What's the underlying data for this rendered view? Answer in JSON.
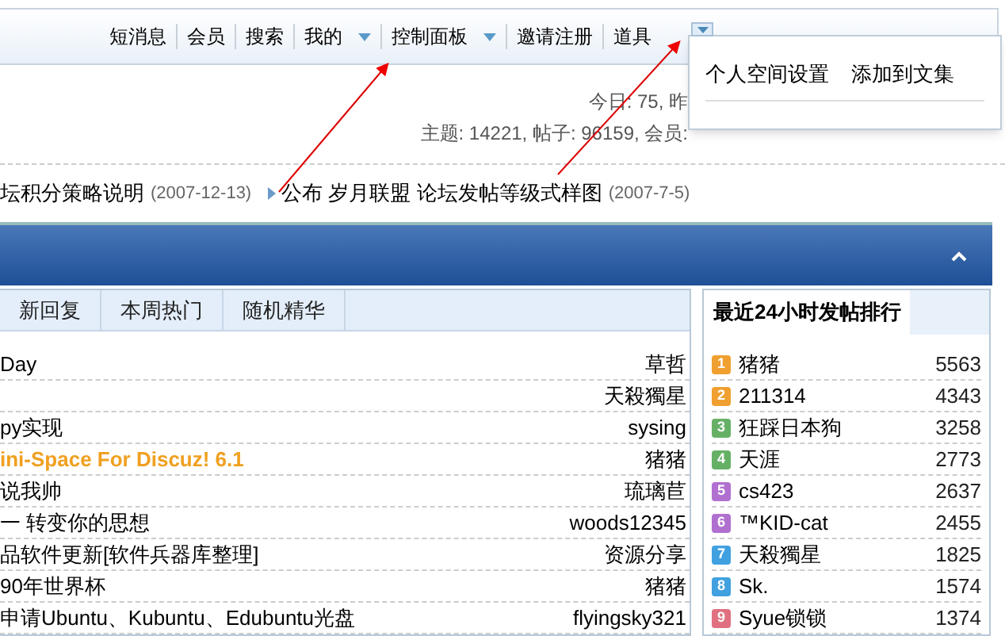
{
  "nav": {
    "items": [
      {
        "label": "短消息",
        "dropdown": false
      },
      {
        "label": "会员",
        "dropdown": false
      },
      {
        "label": "搜索",
        "dropdown": false
      },
      {
        "label": "我的",
        "dropdown": true
      },
      {
        "label": "控制面板",
        "dropdown": true
      },
      {
        "label": "邀请注册",
        "dropdown": false
      },
      {
        "label": "道具",
        "dropdown": false
      }
    ]
  },
  "dropdown_menu": {
    "open": true,
    "items": [
      "个人空间设置",
      "添加到文集"
    ]
  },
  "stats": [
    "今日: 75, 昨",
    "主题: 14221, 帖子: 96159, 会员:"
  ],
  "announcements": [
    {
      "title": "坛积分策略说明",
      "date": "(2007-12-13)"
    },
    {
      "title": "公布 岁月联盟 论坛发帖等级式样图",
      "date": "(2007-7-5)"
    }
  ],
  "tabs": [
    {
      "label": "新回复",
      "selected": false
    },
    {
      "label": "本周热门",
      "selected": false
    },
    {
      "label": "随机精华",
      "selected": false
    }
  ],
  "threads": [
    {
      "title": "Day",
      "author": "草哲",
      "highlight": false
    },
    {
      "author": "天殺獨星"
    },
    {
      "title": "py实现",
      "author": "sysing",
      "highlight": false
    },
    {
      "title": "ini-Space For Discuz! 6.1",
      "author": "猪猪",
      "highlight": true
    },
    {
      "title": "说我帅",
      "author": "琉璃苣",
      "highlight": false
    },
    {
      "title": "一 转变你的思想",
      "author": "woods12345",
      "highlight": false
    },
    {
      "title": "品软件更新[软件兵器库整理]",
      "author": "资源分享",
      "highlight": false
    },
    {
      "title": "90年世界杯",
      "author": "猪猪",
      "highlight": false
    },
    {
      "title": "申请Ubuntu、Kubuntu、Edubuntu光盘",
      "author": "flyingsky321",
      "highlight": false
    }
  ],
  "ranking": {
    "title": "最近24小时发帖排行",
    "rows": [
      {
        "rank": "1",
        "color": "#f0a030",
        "name": "猪猪",
        "count": "5563"
      },
      {
        "rank": "2",
        "color": "#f0a030",
        "name": "211314",
        "count": "4343"
      },
      {
        "rank": "3",
        "color": "#66b066",
        "name": "狂踩日本狗",
        "count": "3258"
      },
      {
        "rank": "4",
        "color": "#66b066",
        "name": "天涯",
        "count": "2773"
      },
      {
        "rank": "5",
        "color": "#b070d0",
        "name": "cs423",
        "count": "2637"
      },
      {
        "rank": "6",
        "color": "#b070d0",
        "name": "™KID-cat",
        "count": "2455"
      },
      {
        "rank": "7",
        "color": "#40a0e0",
        "name": "天殺獨星",
        "count": "1825"
      },
      {
        "rank": "8",
        "color": "#40a0e0",
        "name": "Sk.",
        "count": "1574"
      },
      {
        "rank": "9",
        "color": "#e07080",
        "name": "Syue锁锁",
        "count": "1374"
      }
    ]
  }
}
